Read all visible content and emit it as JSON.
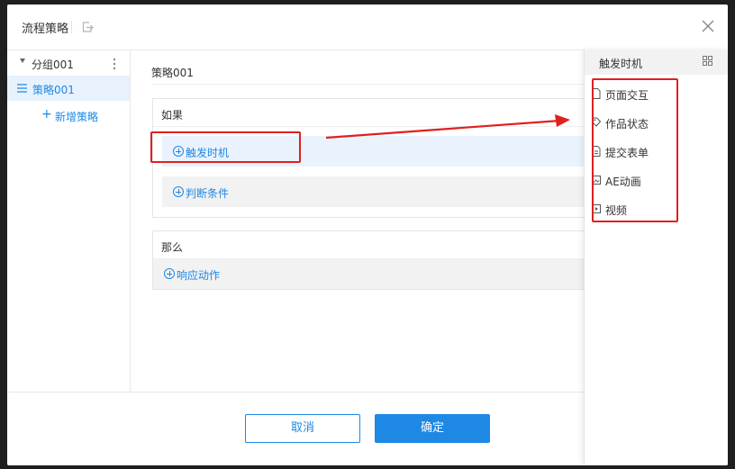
{
  "dialog": {
    "title": "流程策略"
  },
  "sidebar": {
    "group_label": "分组001",
    "items": [
      {
        "label": "策略001",
        "selected": true
      }
    ],
    "add_label": "新增策略"
  },
  "main": {
    "strategy_name": "策略001",
    "if_section": {
      "title": "如果",
      "trigger_button": "触发时机",
      "condition_button": "判断条件"
    },
    "then_section": {
      "title": "那么",
      "action_button": "响应动作"
    }
  },
  "footer": {
    "cancel_label": "取消",
    "confirm_label": "确定"
  },
  "trigger_panel": {
    "title": "触发时机",
    "options": [
      {
        "label": "页面交互",
        "icon": "page-icon"
      },
      {
        "label": "作品状态",
        "icon": "tag-icon"
      },
      {
        "label": "提交表单",
        "icon": "form-icon"
      },
      {
        "label": "AE动画",
        "icon": "animation-icon"
      },
      {
        "label": "视频",
        "icon": "video-icon"
      }
    ]
  },
  "colors": {
    "accent": "#1e88e5",
    "highlight": "#e02020",
    "selected_bg": "#e8f2fd"
  }
}
